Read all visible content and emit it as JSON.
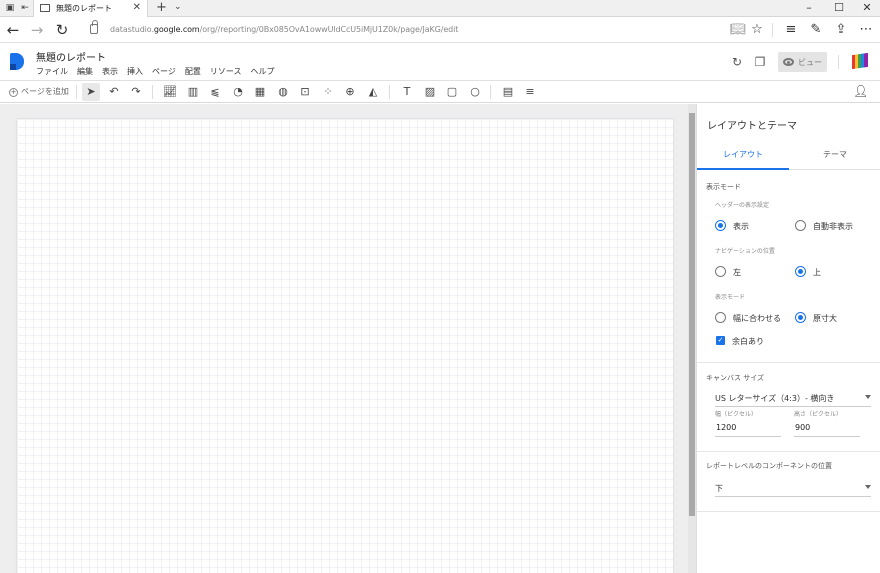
{
  "browser": {
    "tab_title": "無題のレポート",
    "url_prefix": "datastudio.",
    "url_domain": "google.com",
    "url_path": "/org//reporting/0Bx085OvA1owwUldCcU5iMjU1Z0k/page/JaKG/edit"
  },
  "app": {
    "title": "無題のレポート",
    "menu": [
      "ファイル",
      "編集",
      "表示",
      "挿入",
      "ページ",
      "配置",
      "リソース",
      "ヘルプ"
    ],
    "view_label": "ビュー"
  },
  "toolbar": {
    "add_page_label": "ページを追加"
  },
  "panel": {
    "title": "レイアウトとテーマ",
    "tabs": [
      "レイアウト",
      "テーマ"
    ],
    "display_mode_label": "表示モード",
    "header_setting_label": "ヘッダーの表示設定",
    "header_options": [
      "表示",
      "自動非表示"
    ],
    "nav_position_label": "ナビゲーションの位置",
    "nav_options": [
      "左",
      "上"
    ],
    "display_mode_sub_label": "表示モード",
    "fit_options": [
      "幅に合わせる",
      "原寸大"
    ],
    "margin_label": "余白あり",
    "canvas_size_label": "キャンバス サイズ",
    "canvas_size_value": "US レターサイズ（4:3）- 横向き",
    "width_label": "幅（ピクセル）",
    "width_value": "1200",
    "height_label": "高さ（ピクセル）",
    "height_value": "900",
    "component_position_label": "レポートレベルのコンポーネントの位置",
    "component_position_value": "下"
  },
  "colors": {
    "accent": "#1a73e8"
  }
}
